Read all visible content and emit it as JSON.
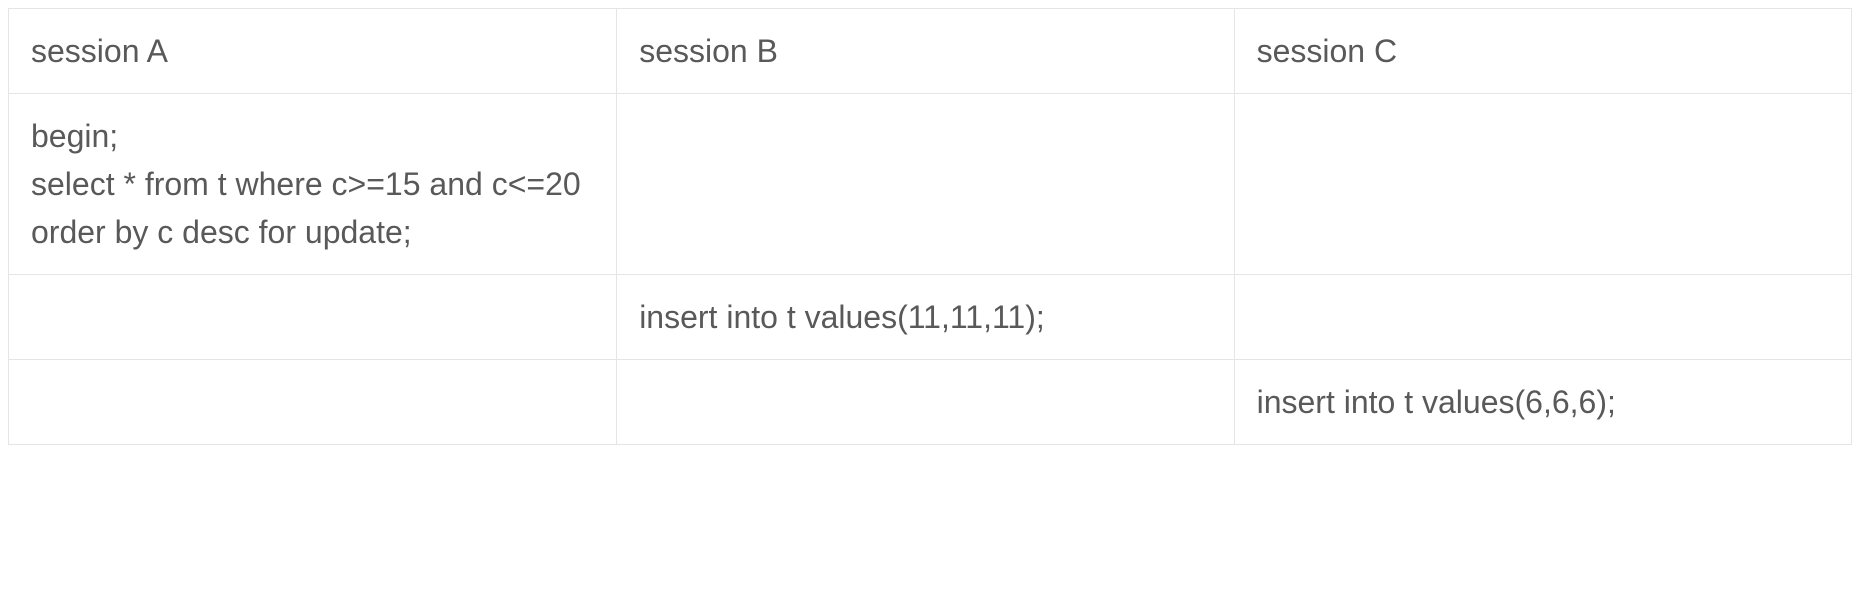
{
  "table": {
    "headers": [
      "session A",
      "session B",
      "session C"
    ],
    "rows": [
      {
        "cells": [
          "begin;\nselect * from t where c>=15 and c<=20 order by c desc  for update;",
          "",
          ""
        ]
      },
      {
        "cells": [
          "",
          "insert into t values(11,11,11);",
          ""
        ]
      },
      {
        "cells": [
          "",
          "",
          "insert into t values(6,6,6);"
        ]
      }
    ]
  }
}
